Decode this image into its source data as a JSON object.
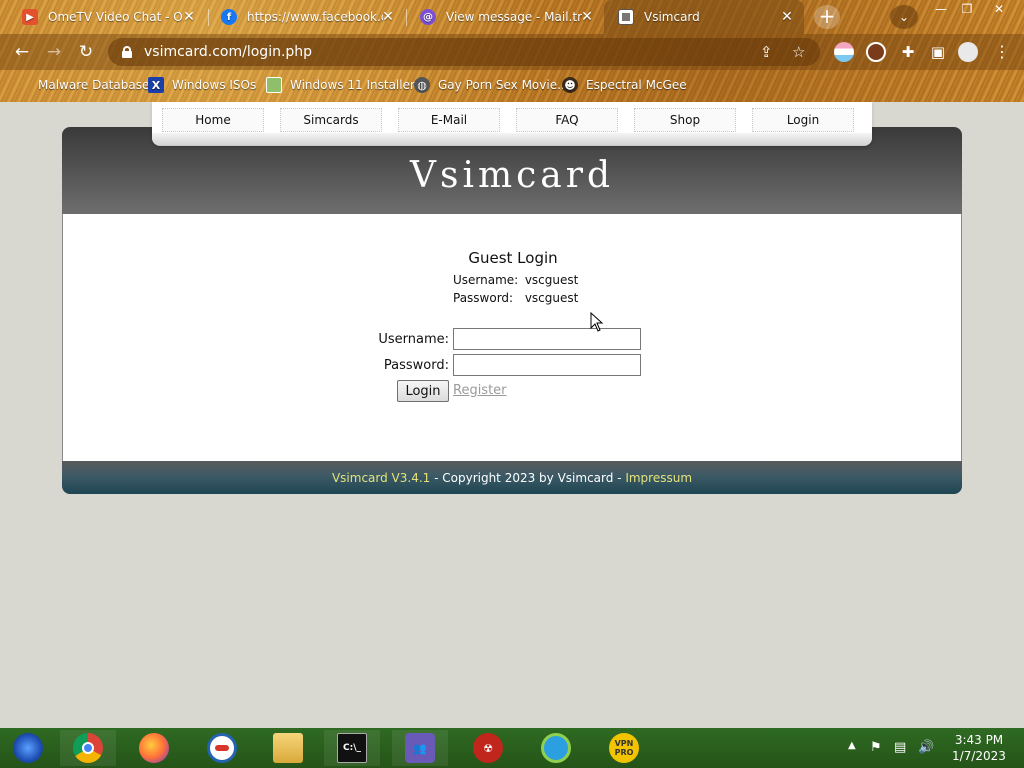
{
  "browser": {
    "tabs": [
      {
        "title": "OmeTV Video Chat - Ome",
        "icon": "ometv-icon",
        "color": "#e3522c"
      },
      {
        "title": "https://www.facebook.com",
        "icon": "facebook-icon",
        "color": "#1877f2"
      },
      {
        "title": "View message - Mail.tm",
        "icon": "mailtm-icon",
        "color": "#7b4fd6"
      },
      {
        "title": "Vsimcard",
        "icon": "vsimcard-icon",
        "color": "#777777"
      }
    ],
    "url": "vsimcard.com/login.php",
    "bookmarks": [
      {
        "label": "Malware Database",
        "icon": "malware-icon"
      },
      {
        "label": "Windows ISOs",
        "icon": "x-icon"
      },
      {
        "label": "Windows 11 Installer",
        "icon": "image-icon"
      },
      {
        "label": "Gay Porn Sex Movie...",
        "icon": "globe-icon"
      },
      {
        "label": "Espectral McGee",
        "icon": "avatar-icon"
      }
    ]
  },
  "site": {
    "title": "Vsimcard",
    "nav": [
      "Home",
      "Simcards",
      "E-Mail",
      "FAQ",
      "Shop",
      "Login"
    ],
    "guest": {
      "heading": "Guest Login",
      "username_label": "Username:",
      "username_value": "vscguest",
      "password_label": "Password:",
      "password_value": "vscguest"
    },
    "form": {
      "username_label": "Username:",
      "password_label": "Password:",
      "username_value": "",
      "password_value": "",
      "login_button": "Login",
      "register_link": "Register"
    },
    "footer": {
      "brand": "Vsimcard V3.4.1",
      "copyright": " - Copyright 2023 by Vsimcard - ",
      "impressum": "Impressum"
    }
  },
  "taskbar": {
    "time": "3:43 PM",
    "date": "1/7/2023"
  }
}
